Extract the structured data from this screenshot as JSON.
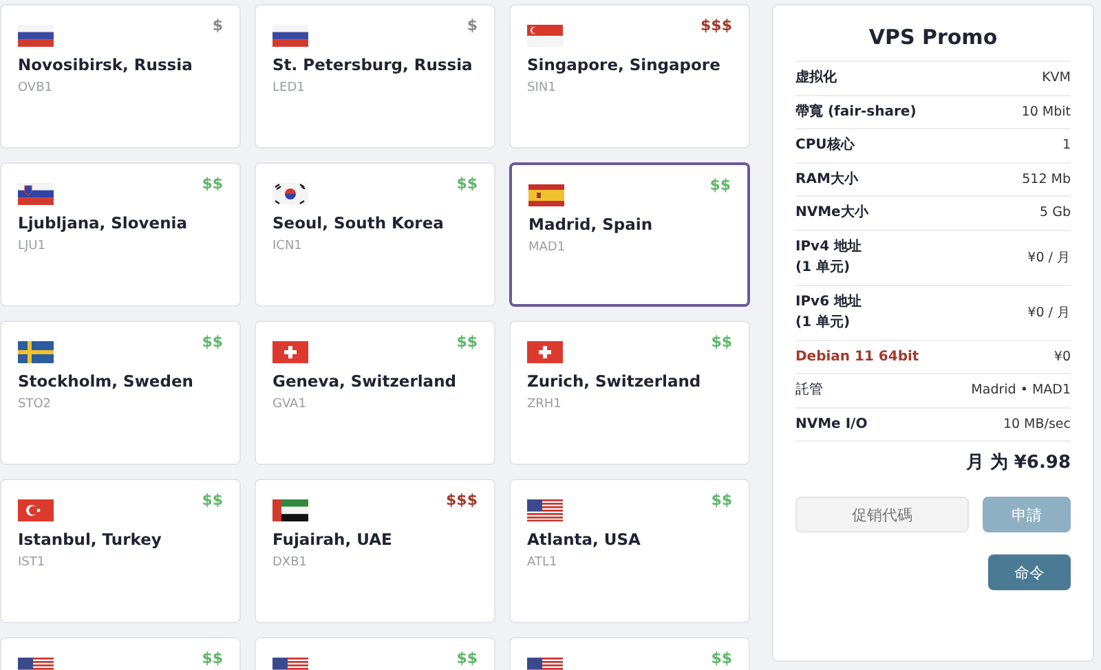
{
  "locations": [
    {
      "kind": "russia",
      "price": "$",
      "color": "#8a8a8a",
      "city": "Novosibirsk, Russia",
      "code": "OVB1",
      "selected": false
    },
    {
      "kind": "russia",
      "price": "$",
      "color": "#8a8a8a",
      "city": "St. Petersburg, Russia",
      "code": "LED1",
      "selected": false
    },
    {
      "kind": "singapore",
      "price": "$$$",
      "color": "#a33a2c",
      "city": "Singapore, Singapore",
      "code": "SIN1",
      "selected": false
    },
    {
      "kind": "slovenia",
      "price": "$$",
      "color": "#5fb86a",
      "city": "Ljubljana, Slovenia",
      "code": "LJU1",
      "selected": false
    },
    {
      "kind": "korea",
      "price": "$$",
      "color": "#5fb86a",
      "city": "Seoul, South Korea",
      "code": "ICN1",
      "selected": false
    },
    {
      "kind": "spain",
      "price": "$$",
      "color": "#5fb86a",
      "city": "Madrid, Spain",
      "code": "MAD1",
      "selected": true
    },
    {
      "kind": "sweden",
      "price": "$$",
      "color": "#5fb86a",
      "city": "Stockholm, Sweden",
      "code": "STO2",
      "selected": false
    },
    {
      "kind": "switzerland",
      "price": "$$",
      "color": "#5fb86a",
      "city": "Geneva, Switzerland",
      "code": "GVA1",
      "selected": false
    },
    {
      "kind": "switzerland",
      "price": "$$",
      "color": "#5fb86a",
      "city": "Zurich, Switzerland",
      "code": "ZRH1",
      "selected": false
    },
    {
      "kind": "turkey",
      "price": "$$",
      "color": "#5fb86a",
      "city": "Istanbul, Turkey",
      "code": "IST1",
      "selected": false
    },
    {
      "kind": "uae",
      "price": "$$$",
      "color": "#a33a2c",
      "city": "Fujairah, UAE",
      "code": "DXB1",
      "selected": false
    },
    {
      "kind": "usa",
      "price": "$$",
      "color": "#5fb86a",
      "city": "Atlanta, USA",
      "code": "ATL1",
      "selected": false
    },
    {
      "kind": "usa",
      "price": "$$",
      "color": "#5fb86a",
      "selected": false
    },
    {
      "kind": "usa",
      "price": "$$",
      "color": "#5fb86a",
      "selected": false
    },
    {
      "kind": "usa",
      "price": "$$",
      "color": "#5fb86a",
      "selected": false
    }
  ],
  "panel": {
    "title": "VPS Promo",
    "specs": [
      {
        "kind": "bold",
        "label": "虚拟化",
        "value": "KVM"
      },
      {
        "kind": "bold",
        "label": "帶寬 (fair-share)",
        "value": "10 Mbit"
      },
      {
        "kind": "bold",
        "label": "CPU核心",
        "value": "1"
      },
      {
        "kind": "bold",
        "label": "RAM大小",
        "value": "512 Mb"
      },
      {
        "kind": "bold",
        "label": "NVMe大小",
        "value": "5 Gb"
      },
      {
        "kind": "bold",
        "label": "IPv4 地址\n(1 单元)",
        "value": "¥0 / 月"
      },
      {
        "kind": "bold",
        "label": "IPv6 地址\n(1 单元)",
        "value": "¥0 / 月"
      },
      {
        "kind": "alert",
        "label": "Debian 11 64bit",
        "value": "¥0"
      },
      {
        "kind": "plain",
        "label": "託管",
        "value": "Madrid • MAD1"
      },
      {
        "kind": "bold",
        "label": "NVMe I/O",
        "value": "10 MB/sec"
      }
    ],
    "total": "月 为 ¥6.98",
    "promo": {
      "placeholder": "促销代碼"
    },
    "apply_button": "申請",
    "order_button": "命令"
  }
}
